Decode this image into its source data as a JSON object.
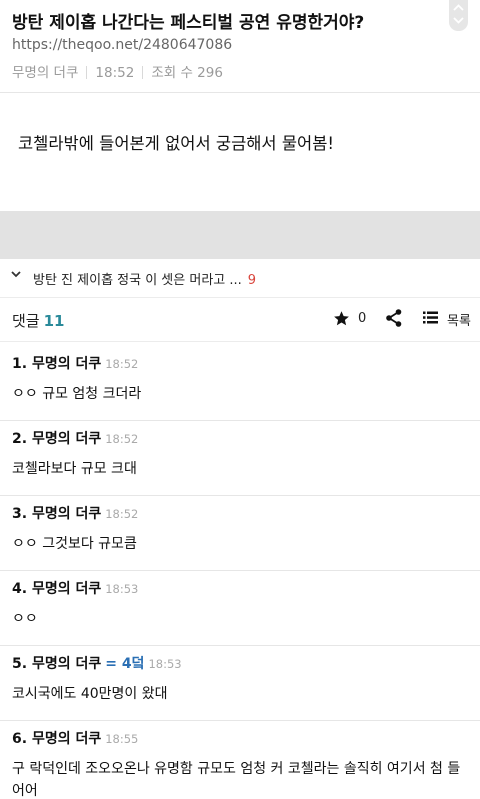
{
  "post": {
    "title": "방탄 제이홉 나간다는 페스티벌 공연 유명한거야?",
    "url": "https://theqoo.net/2480647086",
    "author": "무명의 더쿠",
    "time": "18:52",
    "views_label": "조회 수 296",
    "body": "코첼라밖에 들어본게 없어서 궁금해서 물어봄!"
  },
  "related": {
    "text": "방탄 진 제이홉 정국 이 셋은 머라고 ...",
    "count": "9"
  },
  "toolbar": {
    "comments_label": "댓글",
    "comments_count": "11",
    "star_count": "0",
    "list_label": "목록"
  },
  "comments": [
    {
      "num": "1.",
      "author": "무명의 더쿠",
      "time": "18:52",
      "text": "ㅇㅇ 규모 엄청 크더라"
    },
    {
      "num": "2.",
      "author": "무명의 더쿠",
      "time": "18:52",
      "text": "코첼라보다 규모 크대"
    },
    {
      "num": "3.",
      "author": "무명의 더쿠",
      "time": "18:52",
      "text": "ㅇㅇ 그것보다 규모큼"
    },
    {
      "num": "4.",
      "author": "무명의 더쿠",
      "time": "18:53",
      "text": "ㅇㅇ"
    },
    {
      "num": "5.",
      "author": "무명의 더쿠",
      "mention": "= 4덬",
      "time": "18:53",
      "text": "코시국에도 40만명이 왔대"
    },
    {
      "num": "6.",
      "author": "무명의 더쿠",
      "time": "18:55",
      "text": "구 락덕인데 조오오온나 유명함 규모도 엄청 커 코첼라는 솔직히 여기서 첨 들어어"
    }
  ],
  "icons": {
    "scroll": "chevron-up-down-icon",
    "related": "chevron-down-icon",
    "star": "star-icon",
    "share": "share-icon",
    "list": "list-icon"
  }
}
